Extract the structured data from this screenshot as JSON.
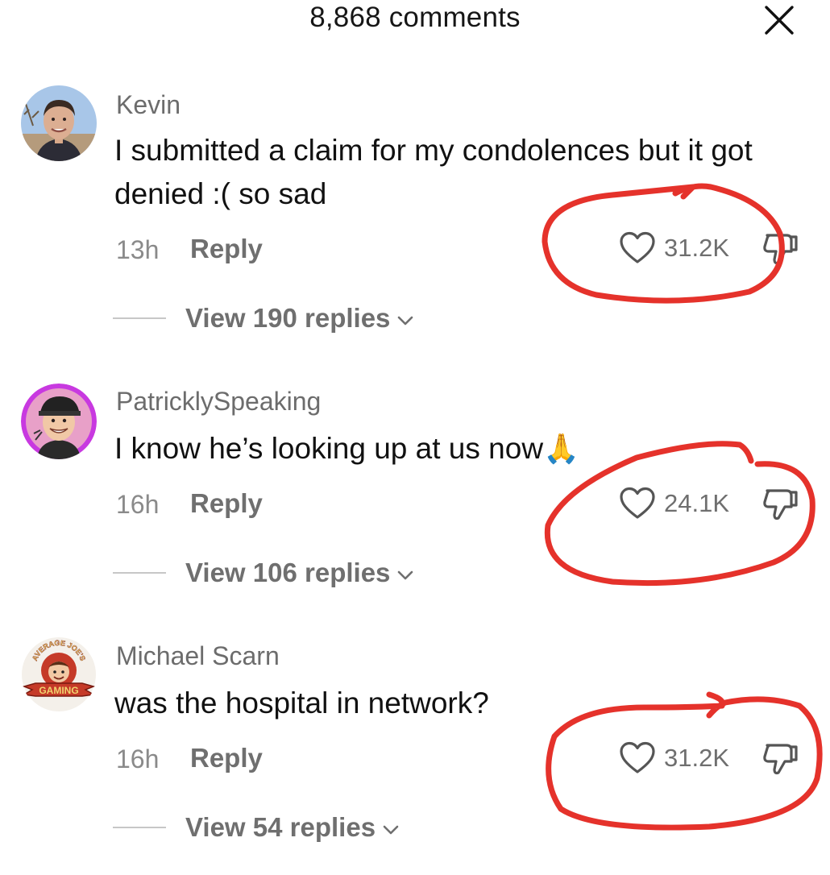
{
  "header": {
    "title": "8,868 comments",
    "close_icon": "close-icon"
  },
  "colors": {
    "annotation": "#e5322b",
    "avatar_ring_2": "#c839e0"
  },
  "comments": [
    {
      "username": "Kevin",
      "text": "I submitted a claim for my condolences but it got denied :( so sad",
      "age": "13h",
      "reply": "Reply",
      "likes": "31.2K",
      "view_replies": "View 190 replies"
    },
    {
      "username": "PatricklySpeaking",
      "text": "I know he’s looking up at us now",
      "emoji": "🙏",
      "age": "16h",
      "reply": "Reply",
      "likes": "24.1K",
      "view_replies": "View 106 replies"
    },
    {
      "username": "Michael Scarn",
      "text": "was the hospital in network?",
      "age": "16h",
      "reply": "Reply",
      "likes": "31.2K",
      "view_replies": "View 54 replies",
      "avatar_logo": {
        "top": "AVERAGE JOE'S",
        "bottom": "GAMING"
      }
    }
  ]
}
